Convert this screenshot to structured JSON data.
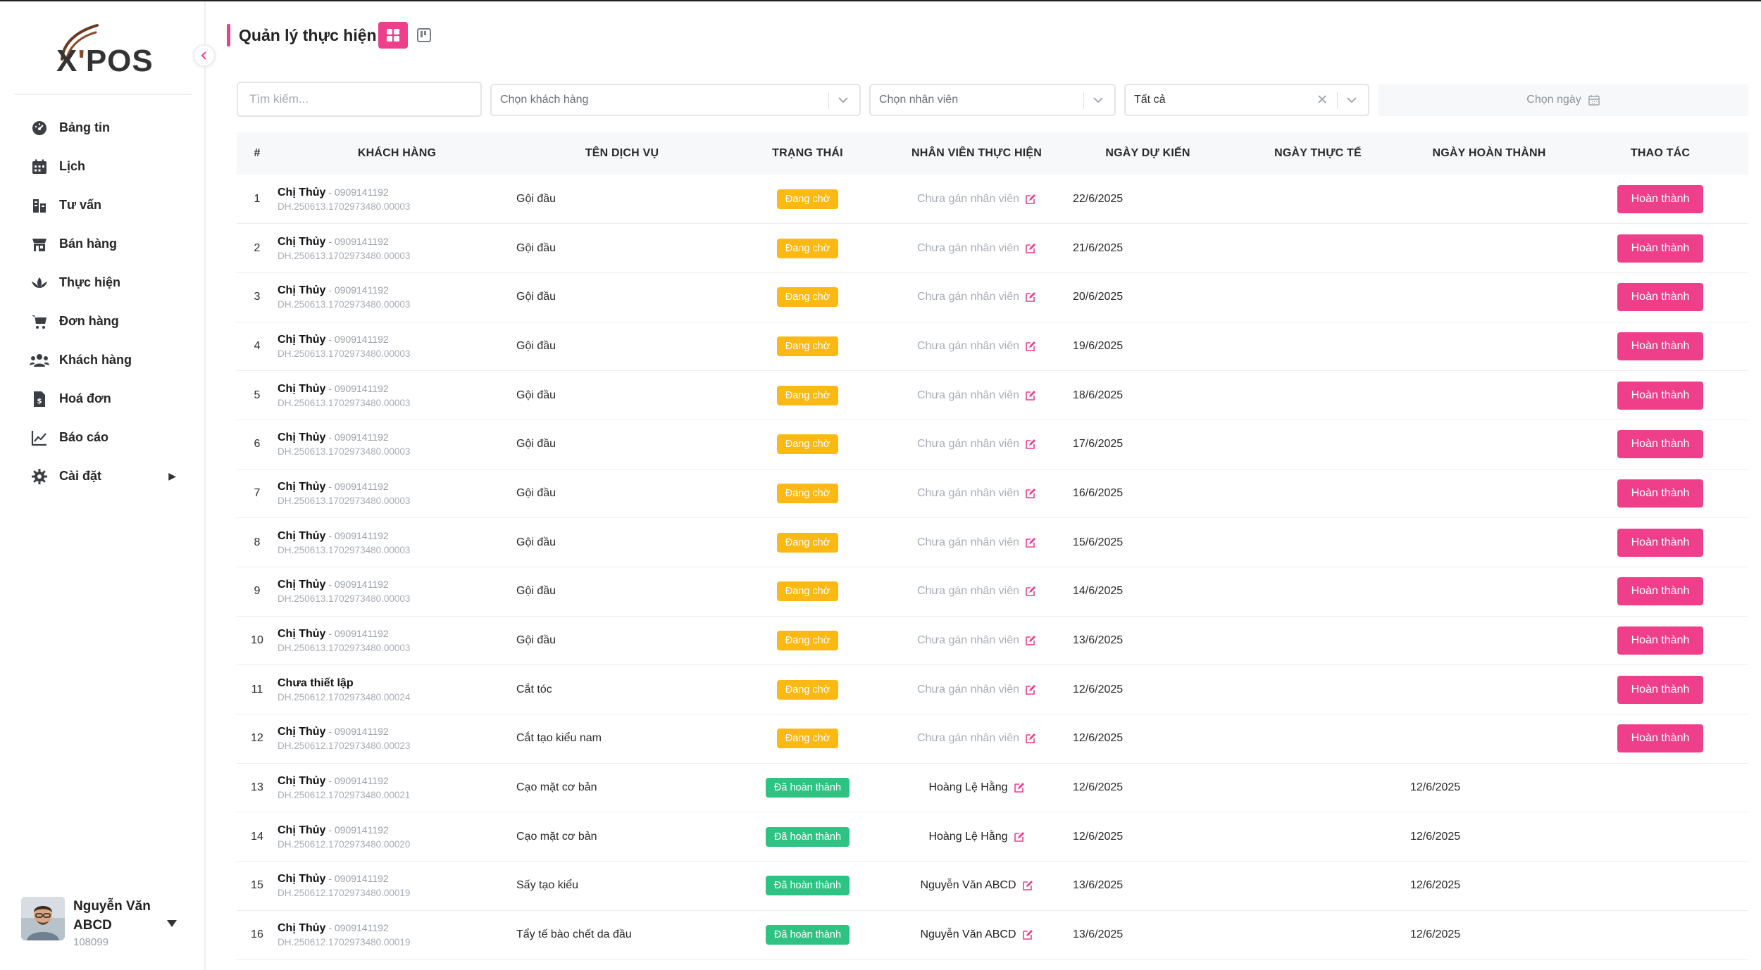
{
  "brand": {
    "logo_main": "X",
    "logo_apos": "'",
    "logo_rest": "POS"
  },
  "sidebar": {
    "items": [
      {
        "label": "Bảng tin",
        "icon": "dashboard-icon"
      },
      {
        "label": "Lịch",
        "icon": "calendar-icon"
      },
      {
        "label": "Tư vấn",
        "icon": "consult-icon"
      },
      {
        "label": "Bán hàng",
        "icon": "store-icon"
      },
      {
        "label": "Thực hiện",
        "icon": "lotus-icon"
      },
      {
        "label": "Đơn hàng",
        "icon": "cart-icon"
      },
      {
        "label": "Khách hàng",
        "icon": "users-icon"
      },
      {
        "label": "Hoá đơn",
        "icon": "invoice-icon"
      },
      {
        "label": "Báo cáo",
        "icon": "chart-icon"
      },
      {
        "label": "Cài đặt",
        "icon": "gear-icon",
        "has_submenu": true
      }
    ],
    "user": {
      "name": "Nguyễn Văn ABCD",
      "id": "108099"
    }
  },
  "header": {
    "title": "Quản lý thực hiện"
  },
  "filters": {
    "search_placeholder": "Tìm kiếm...",
    "customer_placeholder": "Chọn khách hàng",
    "staff_placeholder": "Chọn nhân viên",
    "status_value": "Tất cả",
    "date_placeholder": "Chọn ngày"
  },
  "table": {
    "columns": [
      "#",
      "Khách hàng",
      "Tên dịch vụ",
      "Trạng thái",
      "Nhân viên thực hiện",
      "Ngày dự kiến",
      "Ngày thực tế",
      "Ngày hoàn thành",
      "Thao tác"
    ],
    "action_label": "Hoàn thành",
    "rows": [
      {
        "idx": "1",
        "name": "Chị Thủy",
        "phone": " - 0909141192",
        "code": "DH.250613.1702973480.00003",
        "service": "Gội đầu",
        "status": "Đang chờ",
        "status_type": "wait",
        "staff": "Chưa gán nhân viên",
        "staff_set": false,
        "planned": "22/6/2025",
        "actual": "",
        "completed": "",
        "action": true
      },
      {
        "idx": "2",
        "name": "Chị Thủy",
        "phone": " - 0909141192",
        "code": "DH.250613.1702973480.00003",
        "service": "Gội đầu",
        "status": "Đang chờ",
        "status_type": "wait",
        "staff": "Chưa gán nhân viên",
        "staff_set": false,
        "planned": "21/6/2025",
        "actual": "",
        "completed": "",
        "action": true
      },
      {
        "idx": "3",
        "name": "Chị Thủy",
        "phone": " - 0909141192",
        "code": "DH.250613.1702973480.00003",
        "service": "Gội đầu",
        "status": "Đang chờ",
        "status_type": "wait",
        "staff": "Chưa gán nhân viên",
        "staff_set": false,
        "planned": "20/6/2025",
        "actual": "",
        "completed": "",
        "action": true
      },
      {
        "idx": "4",
        "name": "Chị Thủy",
        "phone": " - 0909141192",
        "code": "DH.250613.1702973480.00003",
        "service": "Gội đầu",
        "status": "Đang chờ",
        "status_type": "wait",
        "staff": "Chưa gán nhân viên",
        "staff_set": false,
        "planned": "19/6/2025",
        "actual": "",
        "completed": "",
        "action": true
      },
      {
        "idx": "5",
        "name": "Chị Thủy",
        "phone": " - 0909141192",
        "code": "DH.250613.1702973480.00003",
        "service": "Gội đầu",
        "status": "Đang chờ",
        "status_type": "wait",
        "staff": "Chưa gán nhân viên",
        "staff_set": false,
        "planned": "18/6/2025",
        "actual": "",
        "completed": "",
        "action": true
      },
      {
        "idx": "6",
        "name": "Chị Thủy",
        "phone": " - 0909141192",
        "code": "DH.250613.1702973480.00003",
        "service": "Gội đầu",
        "status": "Đang chờ",
        "status_type": "wait",
        "staff": "Chưa gán nhân viên",
        "staff_set": false,
        "planned": "17/6/2025",
        "actual": "",
        "completed": "",
        "action": true
      },
      {
        "idx": "7",
        "name": "Chị Thủy",
        "phone": " - 0909141192",
        "code": "DH.250613.1702973480.00003",
        "service": "Gội đầu",
        "status": "Đang chờ",
        "status_type": "wait",
        "staff": "Chưa gán nhân viên",
        "staff_set": false,
        "planned": "16/6/2025",
        "actual": "",
        "completed": "",
        "action": true
      },
      {
        "idx": "8",
        "name": "Chị Thủy",
        "phone": " - 0909141192",
        "code": "DH.250613.1702973480.00003",
        "service": "Gội đầu",
        "status": "Đang chờ",
        "status_type": "wait",
        "staff": "Chưa gán nhân viên",
        "staff_set": false,
        "planned": "15/6/2025",
        "actual": "",
        "completed": "",
        "action": true
      },
      {
        "idx": "9",
        "name": "Chị Thủy",
        "phone": " - 0909141192",
        "code": "DH.250613.1702973480.00003",
        "service": "Gội đầu",
        "status": "Đang chờ",
        "status_type": "wait",
        "staff": "Chưa gán nhân viên",
        "staff_set": false,
        "planned": "14/6/2025",
        "actual": "",
        "completed": "",
        "action": true
      },
      {
        "idx": "10",
        "name": "Chị Thủy",
        "phone": " - 0909141192",
        "code": "DH.250613.1702973480.00003",
        "service": "Gội đầu",
        "status": "Đang chờ",
        "status_type": "wait",
        "staff": "Chưa gán nhân viên",
        "staff_set": false,
        "planned": "13/6/2025",
        "actual": "",
        "completed": "",
        "action": true
      },
      {
        "idx": "11",
        "name": "Chưa thiết lập",
        "phone": "",
        "code": "DH.250612.1702973480.00024",
        "service": "Cắt tóc",
        "status": "Đang chờ",
        "status_type": "wait",
        "staff": "Chưa gán nhân viên",
        "staff_set": false,
        "planned": "12/6/2025",
        "actual": "",
        "completed": "",
        "action": true
      },
      {
        "idx": "12",
        "name": "Chị Thủy",
        "phone": " - 0909141192",
        "code": "DH.250612.1702973480.00023",
        "service": "Cắt tạo kiểu nam",
        "status": "Đang chờ",
        "status_type": "wait",
        "staff": "Chưa gán nhân viên",
        "staff_set": false,
        "planned": "12/6/2025",
        "actual": "",
        "completed": "",
        "action": true
      },
      {
        "idx": "13",
        "name": "Chị Thủy",
        "phone": " - 0909141192",
        "code": "DH.250612.1702973480.00021",
        "service": "Cạo mặt cơ bản",
        "status": "Đã hoàn thành",
        "status_type": "done",
        "staff": "Hoàng Lệ Hằng",
        "staff_set": true,
        "planned": "12/6/2025",
        "actual": "",
        "completed": "12/6/2025",
        "action": false
      },
      {
        "idx": "14",
        "name": "Chị Thủy",
        "phone": " - 0909141192",
        "code": "DH.250612.1702973480.00020",
        "service": "Cạo mặt cơ bản",
        "status": "Đã hoàn thành",
        "status_type": "done",
        "staff": "Hoàng Lệ Hằng",
        "staff_set": true,
        "planned": "12/6/2025",
        "actual": "",
        "completed": "12/6/2025",
        "action": false
      },
      {
        "idx": "15",
        "name": "Chị Thủy",
        "phone": " - 0909141192",
        "code": "DH.250612.1702973480.00019",
        "service": "Sấy tạo kiểu",
        "status": "Đã hoàn thành",
        "status_type": "done",
        "staff": "Nguyễn Văn ABCD",
        "staff_set": true,
        "planned": "13/6/2025",
        "actual": "",
        "completed": "12/6/2025",
        "action": false
      },
      {
        "idx": "16",
        "name": "Chị Thủy",
        "phone": " - 0909141192",
        "code": "DH.250612.1702973480.00019",
        "service": "Tẩy tế bào chết da đầu",
        "status": "Đã hoàn thành",
        "status_type": "done",
        "staff": "Nguyễn Văn ABCD",
        "staff_set": true,
        "planned": "13/6/2025",
        "actual": "",
        "completed": "12/6/2025",
        "action": false
      }
    ]
  }
}
